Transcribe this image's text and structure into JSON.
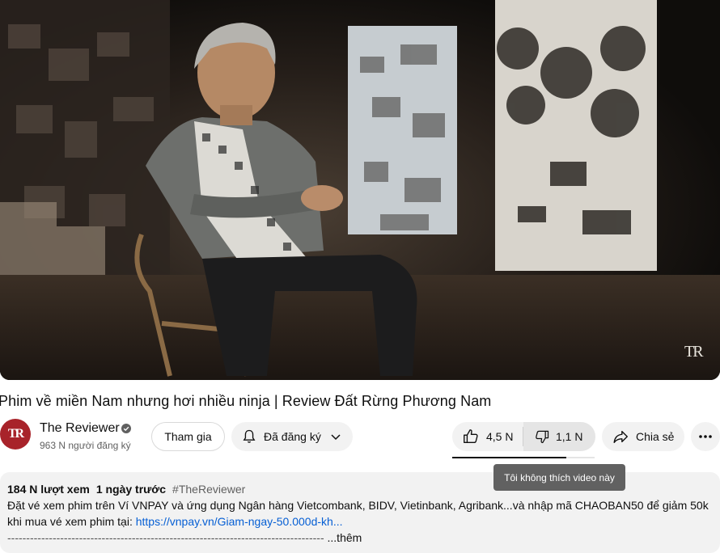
{
  "player": {
    "watermark": "TR"
  },
  "video": {
    "title": "Phim về miền Nam nhưng hơi nhiều ninja | Review Đất Rừng Phương Nam"
  },
  "channel": {
    "avatar_text": "TR",
    "name": "The Reviewer",
    "subscribers": "963 N người đăng ký",
    "verified_icon": "verified-check-icon"
  },
  "actions": {
    "join_label": "Tham gia",
    "subscribed_label": "Đã đăng ký",
    "like_count": "4,5 N",
    "dislike_count": "1,1 N",
    "share_label": "Chia sẻ",
    "like_ratio": 0.8,
    "tooltip": "Tôi không thích video này"
  },
  "description": {
    "views": "184 N lượt xem",
    "time": "1 ngày trước",
    "hashtag": "#TheReviewer",
    "line1": "Đặt vé xem phim trên Ví VNPAY và ứng dụng Ngân hàng Vietcombank, BIDV, Vietinbank, Agribank...và nhập mã CHAOBAN50 để giảm 50k",
    "line2_prefix": "khi mua vé xem phim tại: ",
    "line2_link": "https://vnpay.vn/Giam-ngay-50.000d-kh...",
    "line3_rule": "------------------------------------------------------------------------------------",
    "more_label": "...thêm"
  },
  "colors": {
    "accent_link": "#065fd4",
    "avatar_red": "#a8232a",
    "pill_bg": "#f2f2f2",
    "tooltip_bg": "#616161"
  }
}
